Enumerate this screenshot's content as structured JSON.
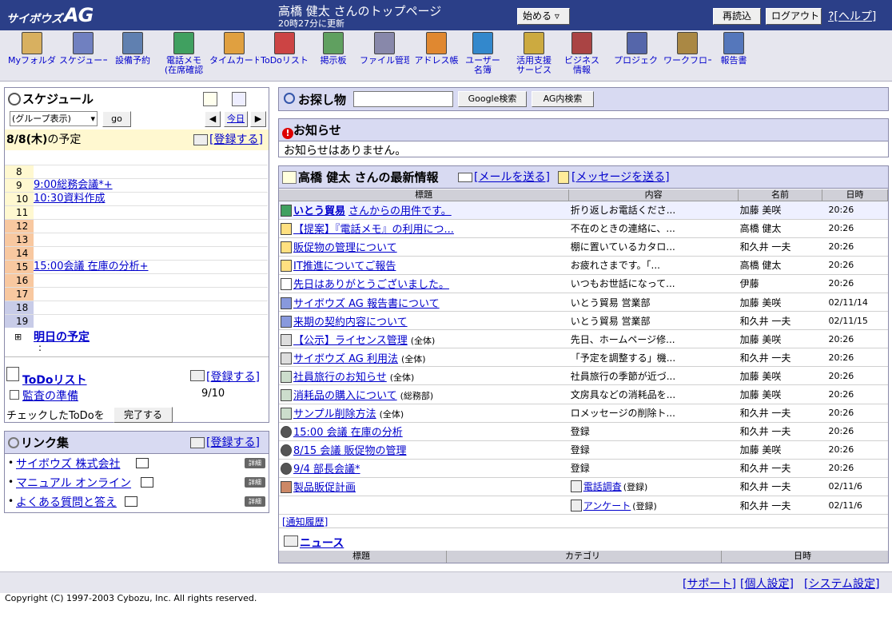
{
  "header": {
    "logo_prefix": "サイボウズ",
    "logo_suffix": "AG",
    "title": "高橋 健太 さんのトップページ",
    "updated": "20時27分に更新",
    "start_label": "始める ▿",
    "reload_label": "再読込",
    "logout_label": "ログアウト",
    "help_label": "?[ヘルプ]"
  },
  "toolbar": [
    {
      "label": "Myフォルダ",
      "icon": "folder-icon"
    },
    {
      "label": "スケジューー",
      "icon": "clock-icon"
    },
    {
      "label": "設備予約",
      "icon": "building-icon"
    },
    {
      "label": "電話メモ\n(在席確認",
      "icon": "phone-icon"
    },
    {
      "label": "タイムカード",
      "icon": "timecard-icon"
    },
    {
      "label": "ToDoリスト",
      "icon": "todo-icon"
    },
    {
      "label": "掲示板",
      "icon": "board-icon"
    },
    {
      "label": "ファイル管理",
      "icon": "file-server-icon"
    },
    {
      "label": "アドレス帳",
      "icon": "address-book-icon"
    },
    {
      "label": "ユーザー\n名簿",
      "icon": "user-list-icon"
    },
    {
      "label": "活用支援\nサービス",
      "icon": "support-icon"
    },
    {
      "label": "ビジネス\n情報",
      "icon": "business-info-icon"
    },
    {
      "label": "プロジェクト",
      "icon": "project-icon"
    },
    {
      "label": "ワークフロー",
      "icon": "workflow-icon"
    },
    {
      "label": "報告書",
      "icon": "report-icon"
    }
  ],
  "schedule": {
    "title": "スケジュール",
    "group_select": "(グループ表示)",
    "go_label": "go",
    "today_label": "今日",
    "prev_label": "◀",
    "next_label": "▶",
    "date_label": "8/8(木)",
    "date_suffix": "の予定",
    "register_label": "[登録する]",
    "hours": [
      {
        "h": "8",
        "event": ""
      },
      {
        "h": "9",
        "event": "9:00総務会議*+"
      },
      {
        "h": "10",
        "event": "10:30資料作成"
      },
      {
        "h": "11",
        "event": ""
      },
      {
        "h": "12",
        "event": ""
      },
      {
        "h": "13",
        "event": ""
      },
      {
        "h": "14",
        "event": ""
      },
      {
        "h": "15",
        "event": "15:00会議 在庫の分析+"
      },
      {
        "h": "16",
        "event": ""
      },
      {
        "h": "17",
        "event": ""
      },
      {
        "h": "18",
        "event": ""
      },
      {
        "h": "19",
        "event": ""
      }
    ],
    "tomorrow_label": "明日の予定",
    "tomorrow_colon": ":"
  },
  "todo": {
    "title": "ToDoリスト",
    "register_label": "[登録する]",
    "item": "監査の準備",
    "item_date": "9/10",
    "check_text": "チェックしたToDoを",
    "done_label": "完了する"
  },
  "links": {
    "title": "リンク集",
    "register_label": "[登録する]",
    "detail_label": "詳細",
    "items": [
      "サイボウズ 株式会社",
      "マニュアル オンライン",
      "よくある質問と答え"
    ]
  },
  "search": {
    "title": "お探し物",
    "input_value": "",
    "google_label": "Google検索",
    "ag_label": "AG内検索"
  },
  "notice": {
    "title": "お知らせ",
    "text": "お知らせはありません。"
  },
  "info": {
    "title": "高橋 健太 さんの最新情報",
    "mail_label": "[メールを送る]",
    "message_label": "[メッセージを送る]",
    "columns": [
      "標題",
      "内容",
      "名前",
      "日時"
    ],
    "rows": [
      {
        "icon": "phone-memo-icon",
        "title": "いとう貿易",
        "title2": "さんからの用件です。",
        "sub": "",
        "content": "折り返しお電話くださ...",
        "name": "加藤 美咲",
        "date": "20:26"
      },
      {
        "icon": "message-icon",
        "title": "【提案】『電話メモ』の利用につ...",
        "title2": "",
        "sub": "",
        "content": "不在のときの連絡に、...",
        "name": "高橋 健太",
        "date": "20:26"
      },
      {
        "icon": "message-icon",
        "title": "販促物の管理について",
        "title2": "",
        "sub": "",
        "content": "棚に置いているカタロ...",
        "name": "和久井 一夫",
        "date": "20:26"
      },
      {
        "icon": "message-icon",
        "title": "IT推進についてご報告",
        "title2": "",
        "sub": "",
        "content": "お疲れさまです。「...",
        "name": "高橋 健太",
        "date": "20:26"
      },
      {
        "icon": "mail-icon",
        "title": "先日はありがとうございました。",
        "title2": "",
        "sub": "",
        "content": "いつもお世話になって...",
        "name": "伊藤",
        "date": "20:26"
      },
      {
        "icon": "report-icon",
        "title": "サイボウズ AG 報告書について",
        "title2": "",
        "sub": "",
        "content": "いとう貿易 営業部",
        "name": "加藤 美咲",
        "date": "02/11/14"
      },
      {
        "icon": "report-icon",
        "title": "来期の契約内容について",
        "title2": "",
        "sub": "",
        "content": "いとう貿易 営業部",
        "name": "和久井 一夫",
        "date": "02/11/15"
      },
      {
        "icon": "board-icon",
        "title": "【公示】ライセンス管理",
        "title2": "",
        "sub": "(全体)",
        "content": "先日、ホームページ修...",
        "name": "加藤 美咲",
        "date": "20:26"
      },
      {
        "icon": "board-icon",
        "title": "サイボウズ AG 利用法",
        "title2": "",
        "sub": "(全体)",
        "content": "「予定を調整する」機...",
        "name": "和久井 一夫",
        "date": "20:26"
      },
      {
        "icon": "bulletin-icon",
        "title": "社員旅行のお知らせ",
        "title2": "",
        "sub": "(全体)",
        "content": "社員旅行の季節が近づ...",
        "name": "加藤 美咲",
        "date": "20:26"
      },
      {
        "icon": "bulletin-icon",
        "title": "消耗品の購入について",
        "title2": "",
        "sub": "(総務部)",
        "content": "文房具などの消耗品を...",
        "name": "加藤 美咲",
        "date": "20:26"
      },
      {
        "icon": "bulletin-icon",
        "title": "サンプル削除方法",
        "title2": "",
        "sub": "(全体)",
        "content": "ロメッセージの削除ト...",
        "name": "和久井 一夫",
        "date": "20:26"
      },
      {
        "icon": "schedule-icon",
        "title": "15:00 会議 在庫の分析",
        "title2": "",
        "sub": "",
        "content": "登録",
        "name": "和久井 一夫",
        "date": "20:26"
      },
      {
        "icon": "schedule-icon",
        "title": "8/15 会議 販促物の管理",
        "title2": "",
        "sub": "",
        "content": "登録",
        "name": "加藤 美咲",
        "date": "20:26"
      },
      {
        "icon": "schedule-icon",
        "title": "9/4 部長会議*",
        "title2": "",
        "sub": "",
        "content": "登録",
        "name": "和久井 一夫",
        "date": "20:26"
      },
      {
        "icon": "project-icon",
        "title": "製品販促計画",
        "title2": "",
        "sub": "",
        "content": "電話調査",
        "content_sub": "(登録)",
        "name": "和久井 一夫",
        "date": "02/11/6"
      },
      {
        "icon": "",
        "title": "",
        "title2": "",
        "sub": "",
        "content": "アンケート",
        "content_sub": "(登録)",
        "name": "和久井 一夫",
        "date": "02/11/6"
      }
    ],
    "history_label": "[通知履歴]"
  },
  "news": {
    "title": "ニュース",
    "columns": [
      "標題",
      "カテゴリ",
      "日時"
    ]
  },
  "footer": {
    "support": "[サポート]",
    "personal": "[個人設定]",
    "system": "[システム設定]",
    "copyright": "Copyright (C) 1997-2003 Cybozu, Inc. All rights reserved."
  }
}
